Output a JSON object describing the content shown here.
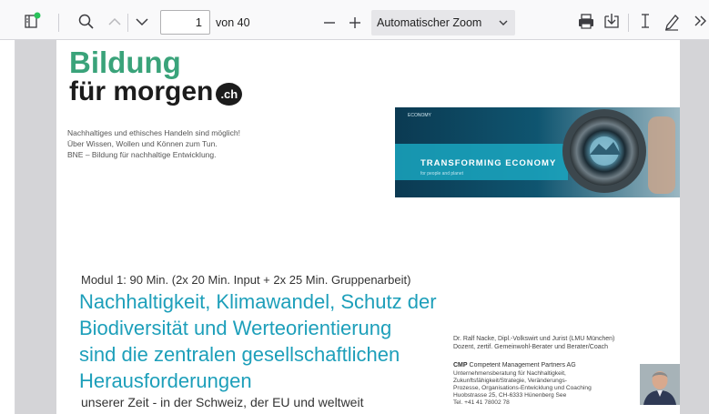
{
  "toolbar": {
    "page_number": "1",
    "page_total": "von 40",
    "zoom_value": "Automatischer Zoom"
  },
  "document": {
    "logo_line1": "Bildung",
    "logo_line2": "für morgen",
    "logo_badge": ".ch",
    "tagline": [
      "Nachhaltiges und ethisches Handeln sind möglich!",
      "Über Wissen, Wollen und Können zum Tun.",
      "BNE – Bildung für nachhaltige Entwicklung."
    ],
    "banner": {
      "brand": "ECONOMY",
      "title": "TRANSFORMING ECONOMY",
      "subtitle": "for people and planet"
    },
    "module_label": "Modul 1:",
    "module_detail": "90 Min. (2x 20 Min. Input + 2x 25 Min. Gruppenarbeit)",
    "heading_lines": [
      "Nachhaltigkeit, Klimawandel, Schutz der",
      "Biodiversität und Werteorientierung",
      "sind die zentralen gesellschaftlichen",
      "Herausforderungen"
    ],
    "subheading": "unserer Zeit - in der Schweiz, der EU und weltweit",
    "author_lines": [
      "Dr. Ralf Nacke, Dipl.-Volkswirt und Jurist (LMU München)",
      "Dozent, zertif. Gemeinwohl-Berater und Berater/Coach"
    ],
    "company_name": "CMP",
    "company_rest": "Competent Management Partners AG",
    "company_lines": [
      "Unternehmensberatung für Nachhaltigkeit,",
      "Zukunftsfähigkeit/Strategie, Veränderungs-",
      "Prozesse, Organisations-Entwicklung und Coaching",
      "Huobstrasse 25, CH-6333 Hünenberg See",
      "Tel. +41 41 78002 78"
    ]
  },
  "colors": {
    "logo_green": "#3aa37a",
    "heading_teal": "#1d9fba",
    "banner_blue": "#0d3c53"
  }
}
